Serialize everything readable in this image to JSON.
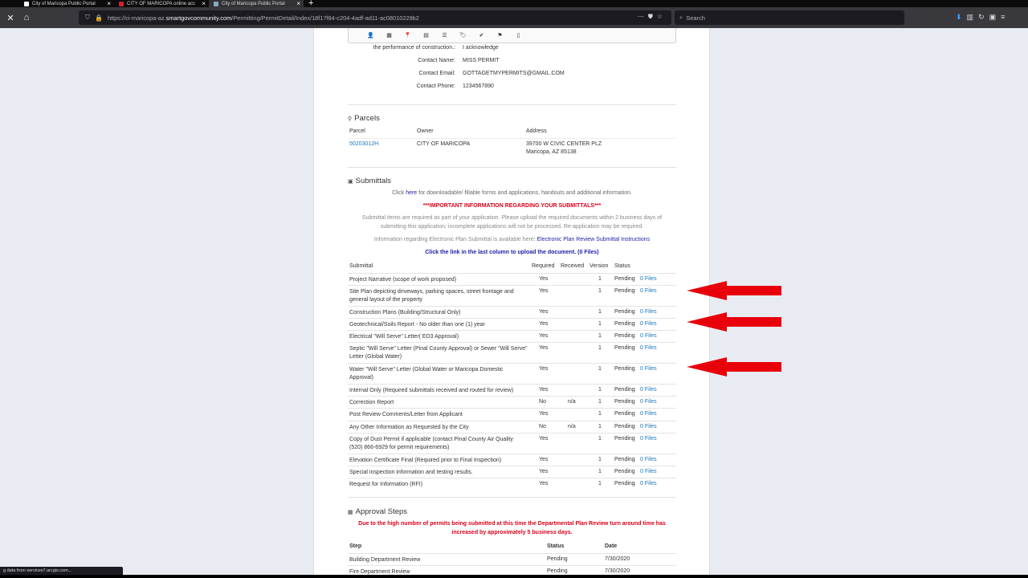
{
  "browser": {
    "tabs": [
      {
        "title": "City of Maricopa Public Portal"
      },
      {
        "title": "CITY OF MARICOPA online acc"
      },
      {
        "title": "City of Maricopa Public Portal"
      }
    ],
    "url_prefix": "https://ci-maricopa-az.",
    "url_domain": "smartgovcommunity.com",
    "url_path": "/Permitting/PermitDetail/Index/18f17f84-c204-4adf-ad11-ac08010229b2",
    "search_placeholder": "Search",
    "status_text": "g data from services7.arcgis.com..."
  },
  "contact": {
    "ack_label": "the performance of construction.:",
    "ack_value": "I acknowledge",
    "name_label": "Contact Name:",
    "name_value": "MISS PERMIT",
    "email_label": "Contact Email:",
    "email_value": "GOTTAGETMYPERMITS@GMAIL.COM",
    "phone_label": "Contact Phone:",
    "phone_value": "1234567890"
  },
  "parcels": {
    "title": "Parcels",
    "headers": {
      "parcel": "Parcel",
      "owner": "Owner",
      "address": "Address"
    },
    "row": {
      "parcel": "50203012H",
      "owner": "CITY OF MARICOPA",
      "address_line1": "39700 W CIVIC CENTER PLZ",
      "address_line2": "Maricopa,  AZ 85138"
    }
  },
  "submittals": {
    "title": "Submittals",
    "click_prefix": "Click ",
    "click_here": "here",
    "click_suffix": " for downloadable/ fillable forms and applications, handouts and additional information.",
    "important": "***IMPORTANT INFORMATION REGARDING YOUR SUBMITTALS***",
    "notice_line1": "Submittal items are required as part of your application. Please upload the required documents within 2 business days of",
    "notice_line2": "submitting this application; incomplete applications will not be processed. Re-application may be required.",
    "eplan_prefix": "Information regarding Electronic Plan Submittal is available here: ",
    "eplan_link": "Electronic Plan Review Submittal Instructions",
    "upload_instruction": "Click the link in the last column to upload the document. (0 Files)",
    "headers": {
      "submittal": "Submittal",
      "required": "Required",
      "received": "Received",
      "version": "Version",
      "status": "Status"
    },
    "rows": [
      {
        "name": "Project Narrative (scope of work proposed)",
        "required": "Yes",
        "received": "",
        "version": "1",
        "status": "Pending",
        "files": "0 Files"
      },
      {
        "name": "Site Plan depicting driveways, parking spaces, street frontage and general layout of the property",
        "required": "Yes",
        "received": "",
        "version": "1",
        "status": "Pending",
        "files": "0 Files"
      },
      {
        "name": "Construction Plans (Building/Structural Only)",
        "required": "Yes",
        "received": "",
        "version": "1",
        "status": "Pending",
        "files": "0 Files"
      },
      {
        "name": "Geotechnical/Soils Report - No older than one (1) year",
        "required": "Yes",
        "received": "",
        "version": "1",
        "status": "Pending",
        "files": "0 Files"
      },
      {
        "name": "Electrical \"Will Serve\" Letter( ED3 Approval)",
        "required": "Yes",
        "received": "",
        "version": "1",
        "status": "Pending",
        "files": "0 Files"
      },
      {
        "name": "Septic \"Will Serve\" Letter (Pinal County Approval) or Sewer \"Will Serve\" Letter (Global Water)",
        "required": "Yes",
        "received": "",
        "version": "1",
        "status": "Pending",
        "files": "0 Files"
      },
      {
        "name": "Water \"Will Serve\" Letter (Global Water or Maricopa Domestic Approval)",
        "required": "Yes",
        "received": "",
        "version": "1",
        "status": "Pending",
        "files": "0 Files"
      },
      {
        "name": "Internal Only (Required submittals received and routed for review)",
        "required": "Yes",
        "received": "",
        "version": "1",
        "status": "Pending",
        "files": "0 Files"
      },
      {
        "name": "Correction Report",
        "required": "No",
        "received": "n/a",
        "version": "1",
        "status": "Pending",
        "files": "0 Files"
      },
      {
        "name": "Post Review Comments/Letter from Applicant",
        "required": "Yes",
        "received": "",
        "version": "1",
        "status": "Pending",
        "files": "0 Files"
      },
      {
        "name": "Any Other Information as Requested by the City",
        "required": "No",
        "received": "n/a",
        "version": "1",
        "status": "Pending",
        "files": "0 Files"
      },
      {
        "name": "Copy of Dust Permit if applicable (contact Pinal County Air Quality (520) 866-6929 for permit requirements)",
        "required": "Yes",
        "received": "",
        "version": "1",
        "status": "Pending",
        "files": "0 Files"
      },
      {
        "name": "Elevation Certificate Final (Required prior to Final Inspection)",
        "required": "Yes",
        "received": "",
        "version": "1",
        "status": "Pending",
        "files": "0 Files"
      },
      {
        "name": "Special inspection information and testing results.",
        "required": "Yes",
        "received": "",
        "version": "1",
        "status": "Pending",
        "files": "0 Files"
      },
      {
        "name": "Request for Information (RFI)",
        "required": "Yes",
        "received": "",
        "version": "1",
        "status": "Pending",
        "files": "0 Files"
      }
    ]
  },
  "approval": {
    "title": "Approval Steps",
    "notice_line1": "Due to the high number of permits being submitted at this time the Departmental Plan Review turn around time has",
    "notice_line2": "increased by approximately 5 business days.",
    "headers": {
      "step": "Step",
      "status": "Status",
      "date": "Date"
    },
    "rows": [
      {
        "step": "Building Department Review",
        "status": "Pending",
        "date": "7/30/2020"
      },
      {
        "step": "Fire Department Review",
        "status": "Pending",
        "date": "7/30/2020"
      }
    ]
  },
  "colors": {
    "arrow": "#e8000b",
    "link": "#1b75bc",
    "alert": "#d9001b"
  }
}
